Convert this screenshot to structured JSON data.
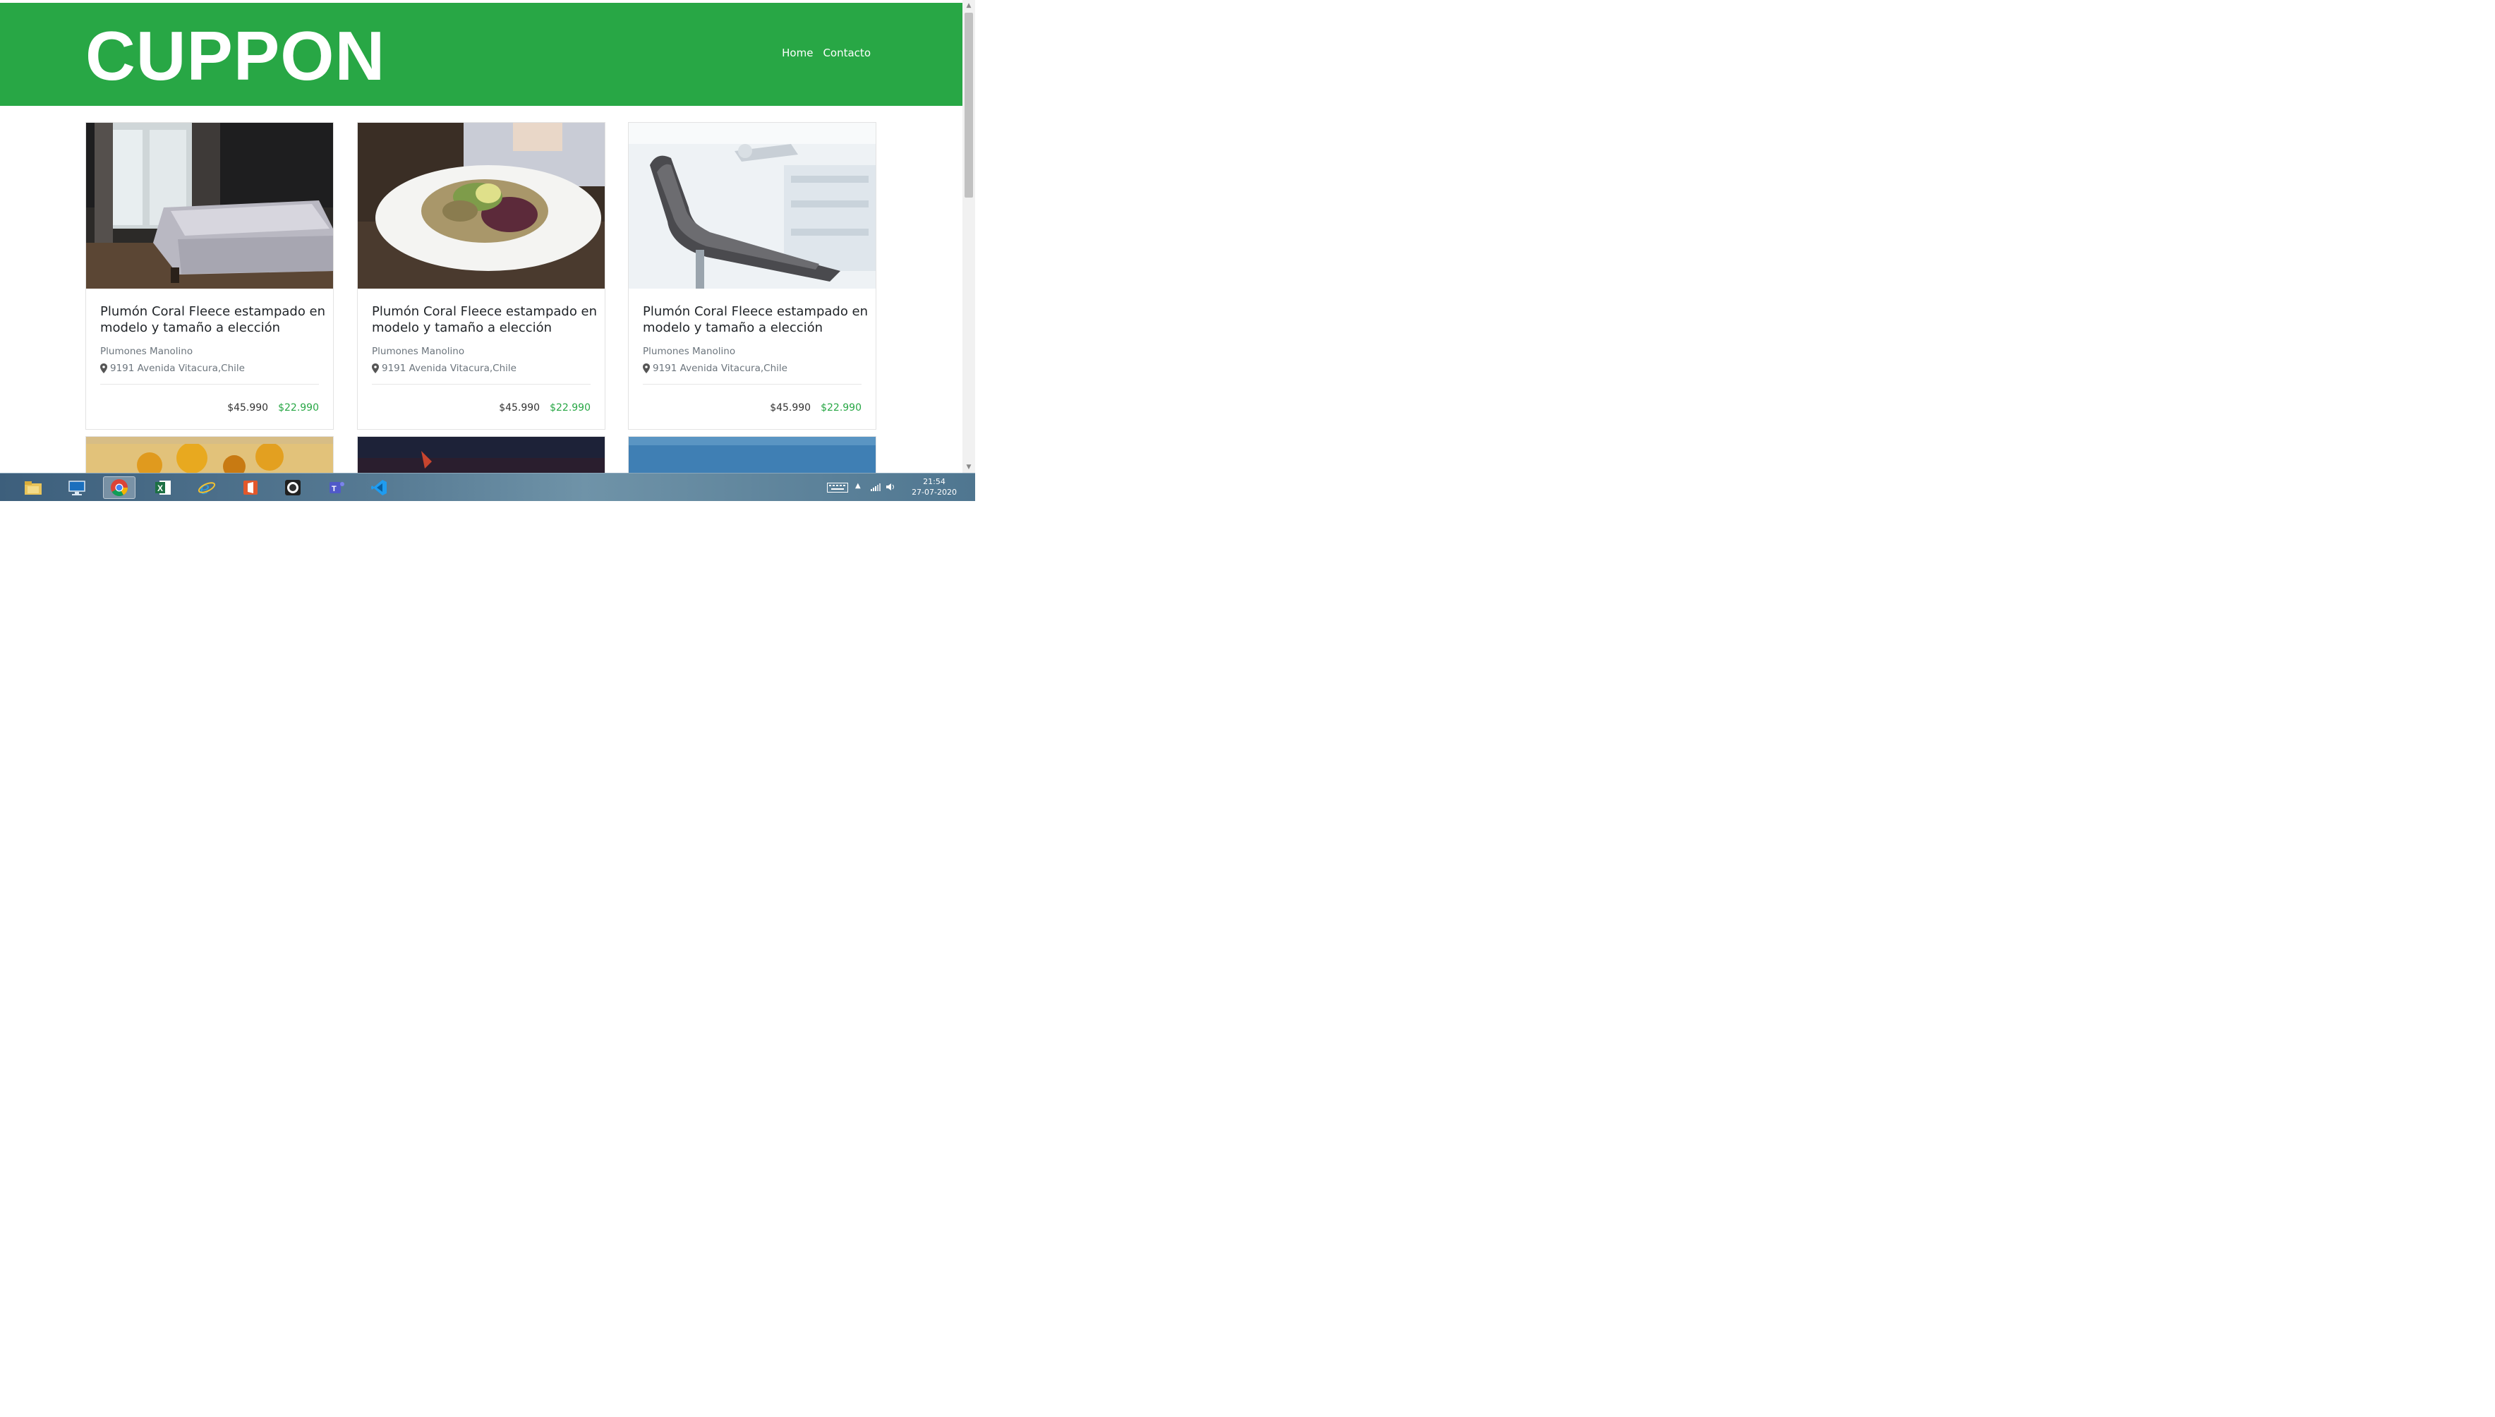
{
  "site": {
    "brand": "CUPPON",
    "nav": [
      "Home",
      "Contacto"
    ]
  },
  "deals": [
    {
      "title": "Plumón Coral Fleece estampado en modelo y tamaño a elección",
      "company": "Plumones Manolino",
      "address": "9191 Avenida Vitacura,Chile",
      "price_old": "$45.990",
      "price_new": "$22.990",
      "image": "bedroom-photo"
    },
    {
      "title": "Plumón Coral Fleece estampado en modelo y tamaño a elección",
      "company": "Plumones Manolino",
      "address": "9191 Avenida Vitacura,Chile",
      "price_old": "$45.990",
      "price_new": "$22.990",
      "image": "salad-plate-photo"
    },
    {
      "title": "Plumón Coral Fleece estampado en modelo y tamaño a elección",
      "company": "Plumones Manolino",
      "address": "9191 Avenida Vitacura,Chile",
      "price_old": "$45.990",
      "price_new": "$22.990",
      "image": "dental-chair-photo"
    }
  ],
  "taskbar": {
    "apps": [
      "file-explorer-icon",
      "remote-desktop-icon",
      "chrome-icon",
      "excel-icon",
      "internet-explorer-icon",
      "office-icon",
      "obs-icon",
      "teams-icon",
      "vscode-icon"
    ],
    "active_app": "chrome-icon",
    "time": "21:54",
    "date": "27-07-2020"
  },
  "colors": {
    "brand_green": "#28a745",
    "price_new": "#28a745",
    "taskbar": "#4f7690"
  }
}
